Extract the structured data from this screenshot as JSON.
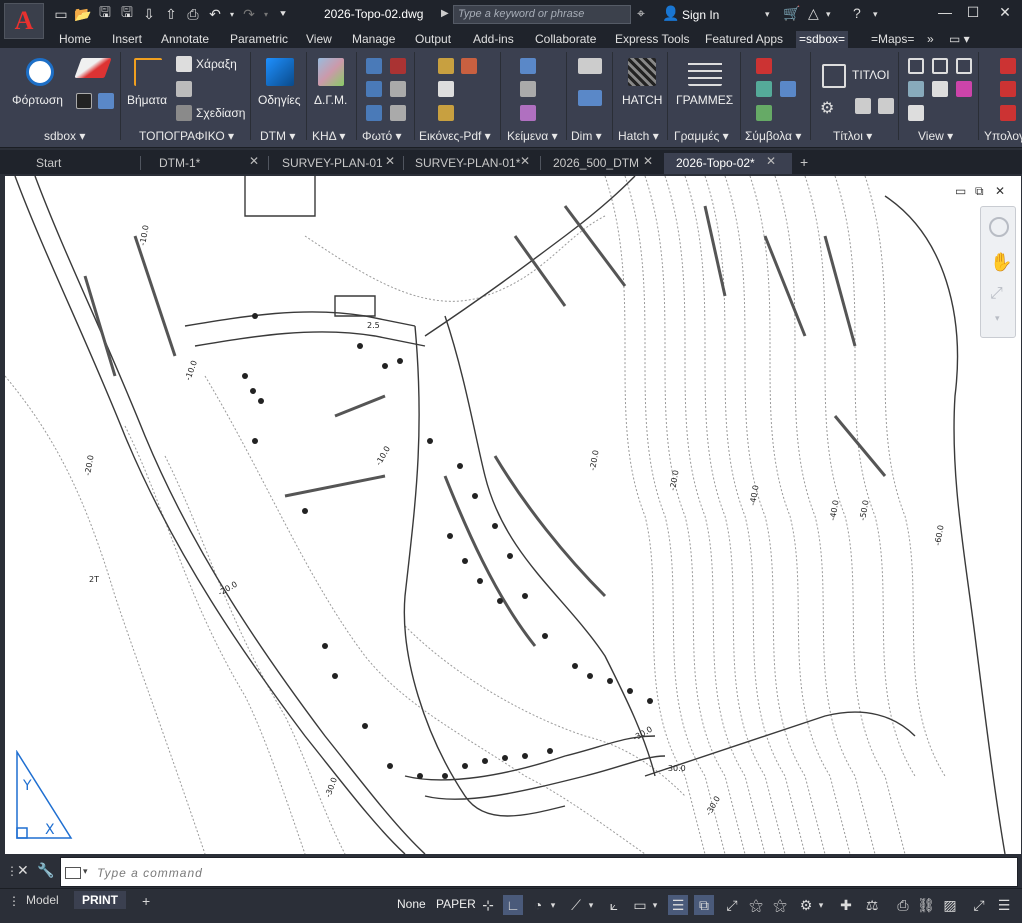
{
  "app": {
    "logo_letter": "A",
    "document_title": "2026-Topo-02.dwg",
    "search_placeholder": "Type a keyword or phrase",
    "sign_in": "Sign In",
    "accent_color": "#e8312f"
  },
  "ribbon_tabs": [
    {
      "label": "Home"
    },
    {
      "label": "Insert"
    },
    {
      "label": "Annotate"
    },
    {
      "label": "Parametric"
    },
    {
      "label": "View"
    },
    {
      "label": "Manage"
    },
    {
      "label": "Output"
    },
    {
      "label": "Add-ins"
    },
    {
      "label": "Collaborate"
    },
    {
      "label": "Express Tools"
    },
    {
      "label": "Featured Apps"
    },
    {
      "label": "=sdbox="
    },
    {
      "label": "=Maps="
    }
  ],
  "ribbon": {
    "sdbox": {
      "title": "sdbox",
      "load_label": "Φόρτωση"
    },
    "topo": {
      "title": "ΤΟΠΟΓΡΑΦΙΚΟ",
      "steps_label": "Βήματα",
      "charaxi_label": "Χάραξη",
      "schedio_label": "Σχεδίαση"
    },
    "dtm": {
      "title": "DTM",
      "odigies_label": "Οδηγίες"
    },
    "khd": {
      "title": "ΚΗΔ",
      "dgm_label": "Δ.Γ.Μ."
    },
    "foto": {
      "title": "Φωτό"
    },
    "eikones": {
      "title": "Εικόνες-Pdf"
    },
    "keimena": {
      "title": "Κείμενα"
    },
    "dim": {
      "title": "Dim"
    },
    "hatch": {
      "title": "Hatch",
      "hatch_label": "HATCH"
    },
    "grammes": {
      "title": "Γραμμές",
      "grammes_label": "ΓΡΑΜΜΕΣ"
    },
    "symvola": {
      "title": "Σύμβολα"
    },
    "titloi": {
      "title": "Τίτλοι",
      "titloi_label": "ΤΙΤΛΟΙ"
    },
    "view": {
      "title": "View"
    },
    "ypologismoi": {
      "title": "Υπολογ"
    }
  },
  "file_tabs": [
    {
      "label": "Start"
    },
    {
      "label": "DTM-1*"
    },
    {
      "label": "SURVEY-PLAN-01"
    },
    {
      "label": "SURVEY-PLAN-01*"
    },
    {
      "label": "2026_500_DTM"
    },
    {
      "label": "2026-Topo-02*"
    }
  ],
  "drawing": {
    "contour_labels": [
      "-10.0",
      "-10.0",
      "-10.0",
      "-20.0",
      "-20.0",
      "-20.0",
      "-20.0",
      "-30.0",
      "-30.0",
      "-30.0",
      "-30.0",
      "-40.0",
      "-40.0",
      "-50.0",
      "-60.0"
    ],
    "point_labels": [
      "2T",
      "2.5"
    ]
  },
  "command": {
    "placeholder": "Type a command"
  },
  "status": {
    "layout_tabs": [
      {
        "label": "Model"
      },
      {
        "label": "PRINT"
      }
    ],
    "none_label": "None",
    "paper_label": "PAPER"
  }
}
